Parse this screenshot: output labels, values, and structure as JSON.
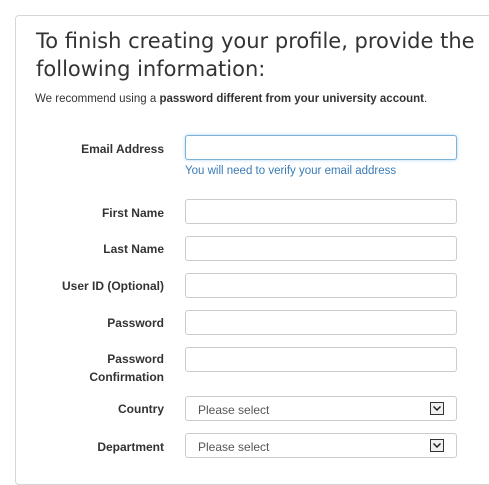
{
  "header": {
    "title": "To finish creating your profile, provide the following information:"
  },
  "notice": {
    "prefix": "We recommend using a ",
    "emphasis": "password different from your university account",
    "suffix": "."
  },
  "form": {
    "email": {
      "label": "Email Address",
      "value": "",
      "help": "You will need to verify your email address"
    },
    "first_name": {
      "label": "First Name",
      "value": ""
    },
    "last_name": {
      "label": "Last Name",
      "value": ""
    },
    "user_id": {
      "label": "User ID (Optional)",
      "value": ""
    },
    "password": {
      "label": "Password",
      "value": ""
    },
    "password_confirmation": {
      "label_line1": "Password",
      "label_line2": "Confirmation",
      "value": ""
    },
    "country": {
      "label": "Country",
      "selected": "Please select"
    },
    "department": {
      "label": "Department",
      "selected": "Please select"
    }
  },
  "icons": {
    "select_arrow": "chevron-down-icon"
  },
  "colors": {
    "help_text": "#3a7bb5",
    "focus_border": "#7ab2d9"
  }
}
